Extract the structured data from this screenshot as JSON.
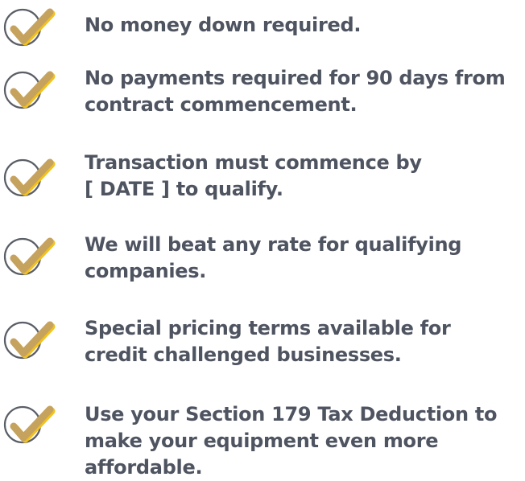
{
  "items": [
    {
      "lines": [
        "No money down required."
      ],
      "icon": "check-circle-icon"
    },
    {
      "lines": [
        "No payments required for 90 days from",
        "contract commencement."
      ],
      "icon": "check-circle-icon"
    },
    {
      "lines": [
        "Transaction must commence by",
        "[ DATE ]  to qualify."
      ],
      "icon": "check-circle-icon"
    },
    {
      "lines": [
        "We will beat any rate for qualifying",
        "companies."
      ],
      "icon": "check-circle-icon"
    },
    {
      "lines": [
        "Special pricing terms available for",
        "credit challenged businesses."
      ],
      "icon": "check-circle-icon"
    },
    {
      "lines": [
        "Use your Section 179 Tax Deduction to",
        "make your equipment even more",
        "affordable."
      ],
      "icon": "check-circle-icon"
    }
  ],
  "colors": {
    "text": "#4f5461",
    "circle": "#5a5e66",
    "check": "#c6a25f",
    "check_shadow": "#f3c21b"
  }
}
